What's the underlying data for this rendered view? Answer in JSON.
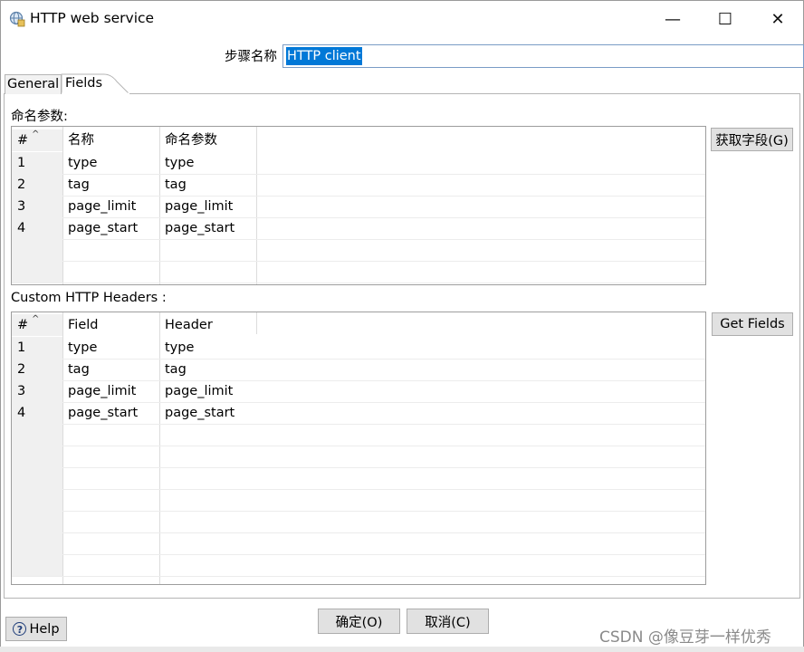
{
  "window": {
    "title": "HTTP web service",
    "minimize": "—",
    "maximize": "☐",
    "close": "✕"
  },
  "step": {
    "label": "步骤名称",
    "value": "HTTP client"
  },
  "tabs": [
    {
      "label": "General"
    },
    {
      "label": "Fields"
    }
  ],
  "named_params": {
    "label": "命名参数:",
    "columns": [
      "#",
      "名称",
      "命名参数"
    ],
    "rows": [
      [
        "1",
        "type",
        "type"
      ],
      [
        "2",
        "tag",
        "tag"
      ],
      [
        "3",
        "page_limit",
        "page_limit"
      ],
      [
        "4",
        "page_start",
        "page_start"
      ]
    ],
    "get_button": "获取字段(G)"
  },
  "headers": {
    "label": "Custom HTTP Headers :",
    "columns": [
      "#",
      "Field",
      "Header"
    ],
    "rows": [
      [
        "1",
        "type",
        "type"
      ],
      [
        "2",
        "tag",
        "tag"
      ],
      [
        "3",
        "page_limit",
        "page_limit"
      ],
      [
        "4",
        "page_start",
        "page_start"
      ]
    ],
    "get_button": "Get Fields"
  },
  "footer": {
    "help": "Help",
    "ok": "确定(O)",
    "cancel": "取消(C)",
    "watermark": "CSDN @像豆芽一样优秀"
  }
}
